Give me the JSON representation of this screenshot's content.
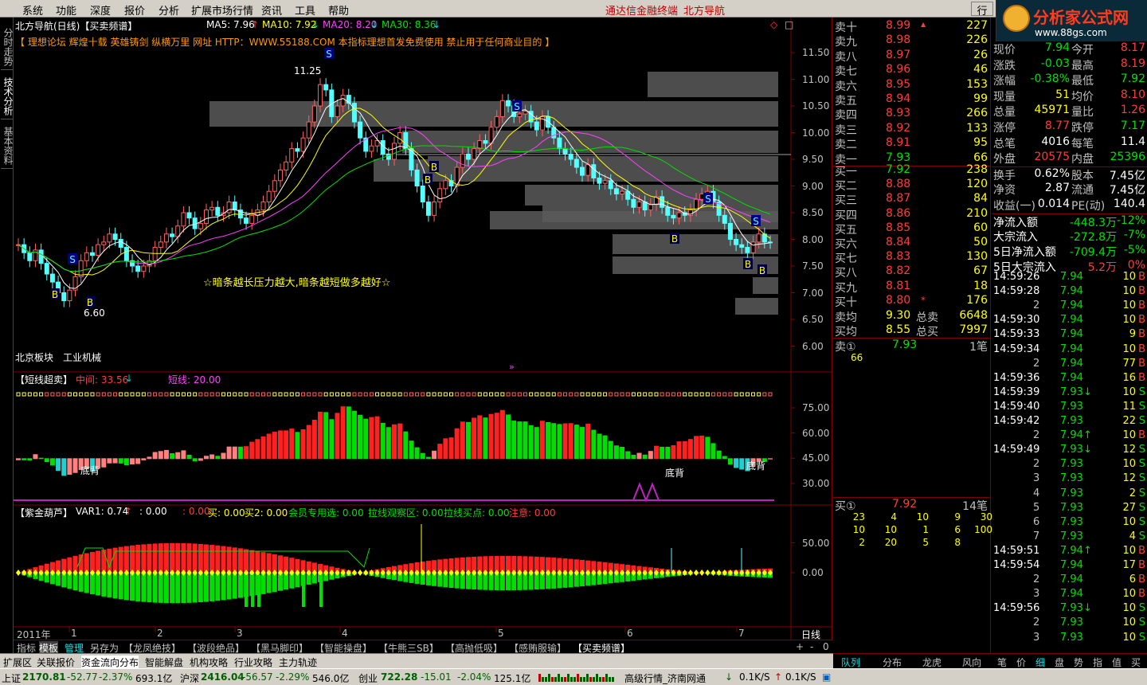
{
  "menu": [
    "系统",
    "功能",
    "深度",
    "报价",
    "分析",
    "扩展市场行情",
    "资讯",
    "工具",
    "帮助"
  ],
  "menu_center": [
    "通达信金融终端",
    "北方导航"
  ],
  "logo": {
    "title": "分析家公式网",
    "url": "www.88gs.com",
    "button": "行"
  },
  "left_tabs": [
    "分时走势",
    "技术分析",
    "基本资料"
  ],
  "main": {
    "title": "北方导航(日线)【买卖频谱】",
    "ma": [
      {
        "label": "MA5: 7.96",
        "color": "#ffffff"
      },
      {
        "label": "MA10: 7.92",
        "color": "#ffff00"
      },
      {
        "label": "MA20: 8.20",
        "color": "#ff40ff"
      },
      {
        "label": "MA30: 8.36",
        "color": "#00e000"
      }
    ],
    "banner": "【 理想论坛  辉煌十载  英雄铸剑  纵横万里  网址 HTTP：WWW.55188.COM  本指标理想首发免费使用  禁止用于任何商业目的 】",
    "note": "☆暗条越长压力越大,暗条越短做多越好☆",
    "sector": [
      "北京板块",
      "工业机械"
    ],
    "high_label": "11.25",
    "low_label": "6.60",
    "yaxis": [
      "11.50",
      "11.00",
      "10.50",
      "10.00",
      "9.50",
      "9.00",
      "8.50",
      "8.00",
      "7.50",
      "7.00",
      "6.50",
      "6.00"
    ]
  },
  "panel2": {
    "title": "【短线超卖】",
    "mid_label": "中间: 33.56",
    "short_label": "短线: 20.00",
    "yaxis": [
      "75.00",
      "60.00",
      "45.00",
      "30.00"
    ],
    "annot": "底背"
  },
  "panel3": {
    "title": "【紫金葫芦】",
    "var": "VAR1: 0.74",
    "v2": ": 0.00",
    "v3": ": 0.00",
    "buy": "买: 0.00",
    "buy2": "买2: 0.00",
    "member": "会员专用选: 0.00",
    "pull": "拉线观察区: 0.00",
    "pullbuy": "拉线买点: 0.00",
    "notice": "注意: 0.00",
    "yaxis": [
      "50.00",
      "0.00"
    ]
  },
  "xaxis": {
    "year": "2011年",
    "months": [
      "1",
      "2",
      "3",
      "4",
      "5",
      "6",
      "7"
    ],
    "period": "日线"
  },
  "bottom_tabs": [
    "指标",
    "模板",
    "管理",
    "另存为",
    "【龙凤绝技】",
    "【波段绝品】",
    "【黑马脚印】",
    "【智能操盘】",
    "【牛熊三SB】",
    "【高抛低吸】",
    "【感贿服输】",
    "【买卖频谱】"
  ],
  "bottom_tools": [
    "+",
    "-",
    "0"
  ],
  "bottom_bar2": [
    "扩展区",
    "关联报价",
    "资金流向分布",
    "智能解盘",
    "机构攻略",
    "行业攻略",
    "主力轨迹"
  ],
  "right_tabs": [
    "队列",
    "分布",
    "龙虎",
    "风向",
    "笔",
    "价",
    "细",
    "盘",
    "势",
    "指",
    "值",
    "买"
  ],
  "sell_levels": [
    {
      "name": "卖十",
      "price": "8.99",
      "vol": "227"
    },
    {
      "name": "卖九",
      "price": "8.98",
      "vol": "226"
    },
    {
      "name": "卖八",
      "price": "8.97",
      "vol": "26"
    },
    {
      "name": "卖七",
      "price": "8.96",
      "vol": "46"
    },
    {
      "name": "卖六",
      "price": "8.95",
      "vol": "153"
    },
    {
      "name": "卖五",
      "price": "8.94",
      "vol": "99"
    },
    {
      "name": "卖四",
      "price": "8.93",
      "vol": "266"
    },
    {
      "name": "卖三",
      "price": "8.92",
      "vol": "133"
    },
    {
      "name": "卖二",
      "price": "8.91",
      "vol": "95"
    },
    {
      "name": "卖一",
      "price": "7.93",
      "vol": "66"
    }
  ],
  "buy_levels": [
    {
      "name": "买一",
      "price": "7.92",
      "vol": "238"
    },
    {
      "name": "买二",
      "price": "8.88",
      "vol": "120"
    },
    {
      "name": "买三",
      "price": "8.87",
      "vol": "84"
    },
    {
      "name": "买四",
      "price": "8.86",
      "vol": "210"
    },
    {
      "name": "买五",
      "price": "8.85",
      "vol": "60"
    },
    {
      "name": "买六",
      "price": "8.84",
      "vol": "50"
    },
    {
      "name": "买七",
      "price": "8.83",
      "vol": "130"
    },
    {
      "name": "买八",
      "price": "8.82",
      "vol": "67"
    },
    {
      "name": "买九",
      "price": "8.81",
      "vol": "18"
    },
    {
      "name": "买十",
      "price": "8.80",
      "vol": "176"
    }
  ],
  "avg": [
    {
      "name": "卖均",
      "price": "9.30",
      "tname": "总卖",
      "vol": "6648"
    },
    {
      "name": "买均",
      "price": "8.55",
      "tname": "总买",
      "vol": "7997"
    }
  ],
  "queue_sell": {
    "name": "卖①",
    "price": "7.93",
    "count": "1笔",
    "vols": [
      "66"
    ]
  },
  "queue_buy": {
    "name": "买①",
    "price": "7.92",
    "count": "14笔",
    "vols": [
      [
        "23",
        "4",
        "10",
        "9",
        "30"
      ],
      [
        "10",
        "10",
        "1",
        "6",
        "100"
      ],
      [
        "2",
        "20",
        "5",
        "8",
        ""
      ]
    ]
  },
  "stats": [
    {
      "k1": "现价",
      "v1": "7.94",
      "c1": "#00e000",
      "k2": "今开",
      "v2": "8.17",
      "c2": "#ff3c3c"
    },
    {
      "k1": "涨跌",
      "v1": "-0.03",
      "c1": "#00e000",
      "k2": "最高",
      "v2": "8.19",
      "c2": "#ff3c3c"
    },
    {
      "k1": "涨幅",
      "v1": "-0.38%",
      "c1": "#00e000",
      "k2": "最低",
      "v2": "7.92",
      "c2": "#00e000"
    },
    {
      "k1": "现量",
      "v1": "51",
      "c1": "#ffff00",
      "k2": "均价",
      "v2": "8.10",
      "c2": "#ff3c3c"
    },
    {
      "k1": "总量",
      "v1": "45971",
      "c1": "#ffff00",
      "k2": "量比",
      "v2": "1.26",
      "c2": "#ff3c3c"
    },
    {
      "k1": "涨停",
      "v1": "8.77",
      "c1": "#ff3c3c",
      "k2": "跌停",
      "v2": "7.17",
      "c2": "#00e000"
    },
    {
      "k1": "总笔",
      "v1": "4016",
      "c1": "#ffffff",
      "k2": "每笔",
      "v2": "11.4",
      "c2": "#ffffff"
    },
    {
      "k1": "外盘",
      "v1": "20575",
      "c1": "#ff3c3c",
      "k2": "内盘",
      "v2": "25396",
      "c2": "#00e000"
    },
    {
      "k1": "换手",
      "v1": "0.62%",
      "c1": "#ffffff",
      "k2": "股本",
      "v2": "7.45亿",
      "c2": "#ffffff"
    },
    {
      "k1": "净资",
      "v1": "2.87",
      "c1": "#ffffff",
      "k2": "流通",
      "v2": "7.45亿",
      "c2": "#ffffff"
    },
    {
      "k1": "收益(一)",
      "v1": "0.014",
      "c1": "#ffffff",
      "k2": "PE(动)",
      "v2": "140.4",
      "c2": "#ffffff"
    }
  ],
  "flow": [
    {
      "k": "净流入额",
      "v": "-448.3万",
      "p": "-12%",
      "c": "#00e000"
    },
    {
      "k": "大宗流入",
      "v": "-272.8万",
      "p": "-7%",
      "c": "#00e000"
    },
    {
      "k": "5日净流入额",
      "v": "-709.4万",
      "p": "-5%",
      "c": "#00e000"
    },
    {
      "k": "5日大宗流入",
      "v": "5.2万",
      "p": "0%",
      "c": "#ff3c3c"
    }
  ],
  "ticks": [
    {
      "t": "14:59:26",
      "p": "7.94",
      "v": "10",
      "d": "B",
      "pc": "#00e000"
    },
    {
      "t": "14:59:28",
      "p": "7.94",
      "v": "10",
      "d": "B",
      "pc": "#00e000"
    },
    {
      "t": "",
      "n": "2",
      "p": "7.94",
      "v": "10",
      "d": "B",
      "pc": "#00e000"
    },
    {
      "t": "14:59:30",
      "p": "7.94",
      "v": "10",
      "d": "B",
      "pc": "#00e000"
    },
    {
      "t": "14:59:33",
      "p": "7.94",
      "v": "9",
      "d": "B",
      "pc": "#00e000"
    },
    {
      "t": "14:59:34",
      "p": "7.94",
      "v": "10",
      "d": "B",
      "pc": "#00e000"
    },
    {
      "t": "",
      "n": "2",
      "p": "7.94",
      "v": "77",
      "d": "B",
      "pc": "#00e000"
    },
    {
      "t": "14:59:36",
      "p": "7.94",
      "v": "16",
      "d": "B",
      "pc": "#00e000"
    },
    {
      "t": "14:59:39",
      "p": "7.93↓",
      "v": "10",
      "d": "S",
      "pc": "#00e000"
    },
    {
      "t": "14:59:40",
      "p": "7.93",
      "v": "11",
      "d": "S",
      "pc": "#00e000"
    },
    {
      "t": "14:59:42",
      "p": "7.93",
      "v": "22",
      "d": "S",
      "pc": "#00e000"
    },
    {
      "t": "",
      "n": "2",
      "p": "7.94↑",
      "v": "10",
      "d": "B",
      "pc": "#00e000"
    },
    {
      "t": "14:59:49",
      "p": "7.93↓",
      "v": "12",
      "d": "S",
      "pc": "#00e000"
    },
    {
      "t": "",
      "n": "2",
      "p": "7.93",
      "v": "10",
      "d": "S",
      "pc": "#00e000"
    },
    {
      "t": "",
      "n": "3",
      "p": "7.93",
      "v": "12",
      "d": "S",
      "pc": "#00e000"
    },
    {
      "t": "",
      "n": "4",
      "p": "7.93",
      "v": "2",
      "d": "S",
      "pc": "#00e000"
    },
    {
      "t": "",
      "n": "5",
      "p": "7.93",
      "v": "27",
      "d": "S",
      "pc": "#00e000"
    },
    {
      "t": "",
      "n": "6",
      "p": "7.93",
      "v": "10",
      "d": "S",
      "pc": "#00e000"
    },
    {
      "t": "",
      "n": "7",
      "p": "7.93",
      "v": "4",
      "d": "S",
      "pc": "#00e000"
    },
    {
      "t": "14:59:51",
      "p": "7.94↑",
      "v": "10",
      "d": "B",
      "pc": "#00e000"
    },
    {
      "t": "14:59:54",
      "p": "7.94",
      "v": "17",
      "d": "B",
      "pc": "#00e000"
    },
    {
      "t": "",
      "n": "2",
      "p": "7.94",
      "v": "6",
      "d": "B",
      "pc": "#00e000"
    },
    {
      "t": "",
      "n": "3",
      "p": "7.94",
      "v": "10",
      "d": "B",
      "pc": "#00e000"
    },
    {
      "t": "14:59:56",
      "p": "7.93↓",
      "v": "10",
      "d": "S",
      "pc": "#00e000"
    },
    {
      "t": "",
      "n": "2",
      "p": "7.93",
      "v": "10",
      "d": "S",
      "pc": "#00e000"
    },
    {
      "t": "",
      "n": "3",
      "p": "7.93",
      "v": "10",
      "d": "S",
      "pc": "#00e000"
    }
  ],
  "status": [
    {
      "k": "上证",
      "v": "2170.81",
      "c": "#006000",
      "d": "-52.77",
      "p": "-2.37%",
      "a": "693.1亿"
    },
    {
      "k": "沪深",
      "v": "2416.04",
      "c": "#006000",
      "d": "-56.57",
      "p": "-2.29%",
      "a": "546.0亿"
    },
    {
      "k": "创业",
      "v": "722.28",
      "c": "#006000",
      "d": "-15.01",
      "p": "-2.04%",
      "a": "125.1亿"
    }
  ],
  "status_right": {
    "site": "高级行情_济南网通",
    "speed1": "0.1K/S",
    "speed2": "0.1K/S"
  },
  "colors": {
    "up": "#ff3c3c",
    "down": "#00e000",
    "ma5": "#ffffff",
    "ma10": "#ffff00",
    "ma20": "#ff40ff",
    "ma30": "#00e000"
  }
}
